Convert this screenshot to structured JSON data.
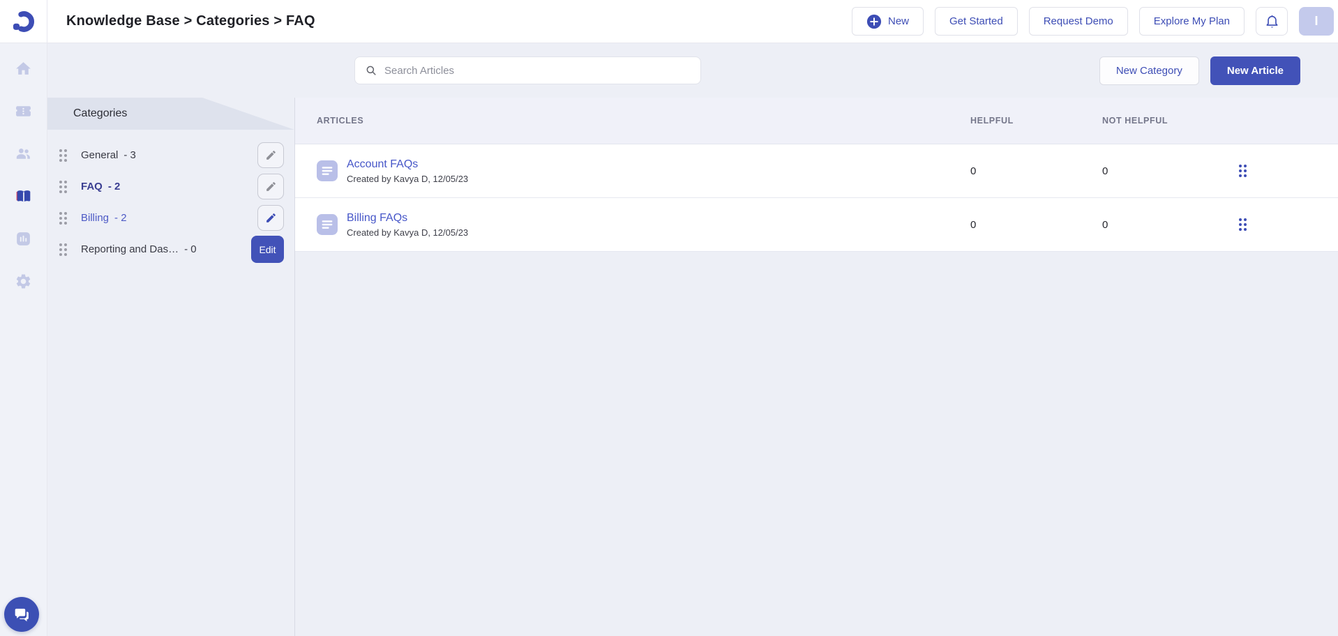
{
  "header": {
    "breadcrumb": "Knowledge Base > Categories > FAQ",
    "actions": {
      "new": "New",
      "get_started": "Get Started",
      "request_demo": "Request Demo",
      "explore_plan": "Explore My Plan"
    },
    "avatar_initial": "I"
  },
  "sidebar": {
    "icons": [
      "home-icon",
      "ticket-icon",
      "contacts-icon",
      "knowledge-base-icon",
      "reports-icon",
      "settings-icon",
      "chat-icon"
    ],
    "active_icon": "knowledge-base-icon"
  },
  "toolbar": {
    "search_placeholder": "Search Articles",
    "search_value": "",
    "new_category": "New Category",
    "new_article": "New Article"
  },
  "categories": {
    "title": "Categories",
    "items": [
      {
        "name": "General",
        "count_label": "- 3",
        "state": "default",
        "action": "pencil"
      },
      {
        "name": "FAQ",
        "count_label": "- 2",
        "state": "selected",
        "action": "pencil"
      },
      {
        "name": "Billing",
        "count_label": "- 2",
        "state": "hovered",
        "action": "pencil-active"
      },
      {
        "name": "Reporting and Das…",
        "count_label": "- 0",
        "state": "default",
        "action": "edit-button",
        "edit_label": "Edit"
      }
    ]
  },
  "table": {
    "columns": [
      "ARTICLES",
      "HELPFUL",
      "NOT HELPFUL"
    ],
    "rows": [
      {
        "title": "Account FAQs",
        "meta": "Created by Kavya D, 12/05/23",
        "helpful": "0",
        "not_helpful": "0"
      },
      {
        "title": "Billing FAQs",
        "meta": "Created by Kavya D, 12/05/23",
        "helpful": "0",
        "not_helpful": "0"
      }
    ]
  },
  "colors": {
    "accent": "#3D4DB5",
    "primary_button": "#4252B8",
    "link": "#4656C8",
    "rail_inactive_icon": "#C3C9E6",
    "category_band": "#DEE2ED",
    "content_background": "#EDEFF6",
    "avatar_background": "#C4CAEC"
  }
}
